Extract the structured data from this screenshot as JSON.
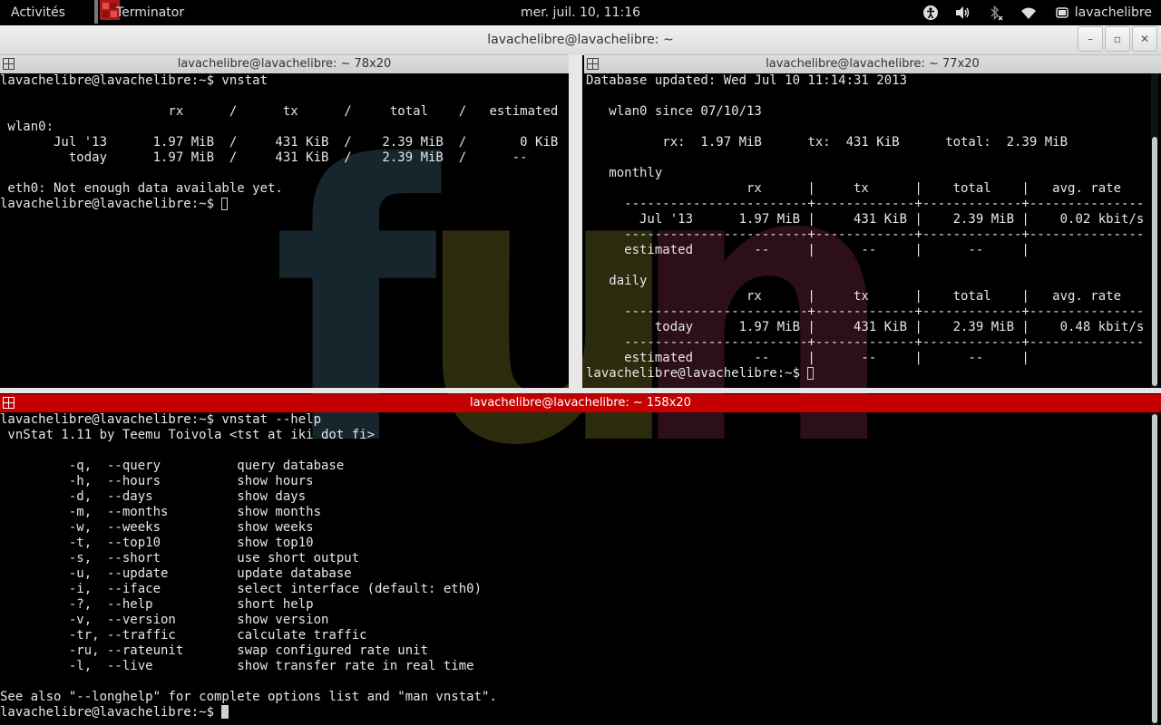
{
  "topbar": {
    "activities": "Activités",
    "app_name": "Terminator",
    "clock": "mer. juil. 10, 11:16",
    "user": "lavachelibre"
  },
  "window": {
    "title": "lavachelibre@lavachelibre: ~",
    "buttons": {
      "minimize": "–",
      "maximize": "▫",
      "close": "✕"
    }
  },
  "panes": {
    "top_left": {
      "title": "lavachelibre@lavachelibre: ~ 78x20",
      "lines": [
        "lavachelibre@lavachelibre:~$ vnstat",
        "",
        "                      rx      /      tx      /     total    /   estimated",
        " wlan0:",
        "       Jul '13      1.97 MiB  /     431 KiB  /    2.39 MiB  /       0 KiB",
        "         today      1.97 MiB  /     431 KiB  /    2.39 MiB  /      --",
        "",
        " eth0: Not enough data available yet."
      ],
      "prompt": "lavachelibre@lavachelibre:~$ "
    },
    "top_right": {
      "title": "lavachelibre@lavachelibre: ~ 77x20",
      "lines": [
        "Database updated: Wed Jul 10 11:14:31 2013",
        "",
        "   wlan0 since 07/10/13",
        "",
        "          rx:  1.97 MiB      tx:  431 KiB      total:  2.39 MiB",
        "",
        "   monthly",
        "                     rx      |     tx      |    total    |   avg. rate",
        "     ------------------------+-------------+-------------+---------------",
        "       Jul '13      1.97 MiB |     431 KiB |    2.39 MiB |    0.02 kbit/s",
        "     ------------------------+-------------+-------------+---------------",
        "     estimated        --     |      --     |      --     |",
        "",
        "   daily",
        "                     rx      |     tx      |    total    |   avg. rate",
        "     ------------------------+-------------+-------------+---------------",
        "         today      1.97 MiB |     431 KiB |    2.39 MiB |    0.48 kbit/s",
        "     ------------------------+-------------+-------------+---------------",
        "     estimated        --     |      --     |      --     |"
      ],
      "prompt": "lavachelibre@lavachelibre:~$ "
    },
    "bottom": {
      "title": "lavachelibre@lavachelibre: ~ 158x20",
      "lines": [
        "lavachelibre@lavachelibre:~$ vnstat --help",
        " vnStat 1.11 by Teemu Toivola <tst at iki dot fi>",
        "",
        "         -q,  --query          query database",
        "         -h,  --hours          show hours",
        "         -d,  --days           show days",
        "         -m,  --months         show months",
        "         -w,  --weeks          show weeks",
        "         -t,  --top10          show top10",
        "         -s,  --short          use short output",
        "         -u,  --update         update database",
        "         -i,  --iface          select interface (default: eth0)",
        "         -?,  --help           short help",
        "         -v,  --version        show version",
        "         -tr, --traffic        calculate traffic",
        "         -ru, --rateunit       swap configured rate unit",
        "         -l,  --live           show transfer rate in real time",
        "",
        "See also \"--longhelp\" for complete options list and \"man vnstat\"."
      ],
      "prompt": "lavachelibre@lavachelibre:~$ "
    }
  },
  "wallpaper": {
    "f": "f",
    "u": "u",
    "n": "n"
  },
  "colors": {
    "active_pane": "#c40000",
    "fun_f": "#16262c",
    "fun_u": "#2d2b0e",
    "fun_n": "#2c0f18"
  },
  "icons": [
    "terminator-icon",
    "accessibility-icon",
    "volume-icon",
    "bluetooth-disabled-icon",
    "wifi-icon",
    "user-icon",
    "split-grid-icon"
  ]
}
